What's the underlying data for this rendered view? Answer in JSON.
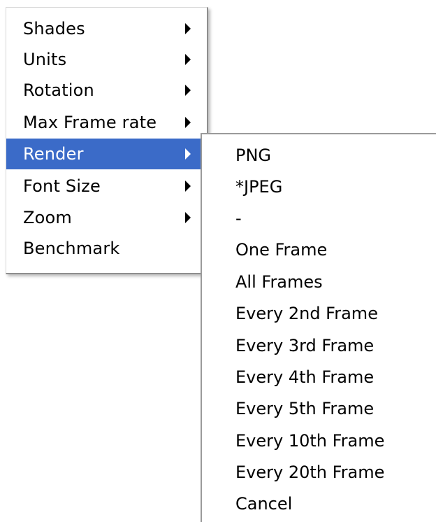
{
  "menu": {
    "items": [
      {
        "label": "Shades",
        "has_submenu": true
      },
      {
        "label": "Units",
        "has_submenu": true
      },
      {
        "label": "Rotation",
        "has_submenu": true
      },
      {
        "label": "Max Frame rate",
        "has_submenu": true
      },
      {
        "label": "Render",
        "has_submenu": true,
        "selected": true
      },
      {
        "label": "Font Size",
        "has_submenu": true
      },
      {
        "label": "Zoom",
        "has_submenu": true
      },
      {
        "label": "Benchmark",
        "has_submenu": false
      }
    ]
  },
  "submenu": {
    "items": [
      {
        "label": "PNG"
      },
      {
        "label": "*JPEG"
      },
      {
        "label": "-"
      },
      {
        "label": "One Frame"
      },
      {
        "label": "All Frames"
      },
      {
        "label": "Every 2nd Frame"
      },
      {
        "label": "Every 3rd Frame"
      },
      {
        "label": "Every 4th Frame"
      },
      {
        "label": "Every 5th Frame"
      },
      {
        "label": "Every 10th Frame"
      },
      {
        "label": "Every 20th Frame"
      },
      {
        "label": "Cancel"
      }
    ]
  },
  "colors": {
    "selection_background": "#3b6bc8",
    "selection_text": "#ffffff",
    "menu_background": "#ffffff",
    "text": "#000000"
  },
  "icons": {
    "submenu_arrow": "chevron-right-icon"
  }
}
